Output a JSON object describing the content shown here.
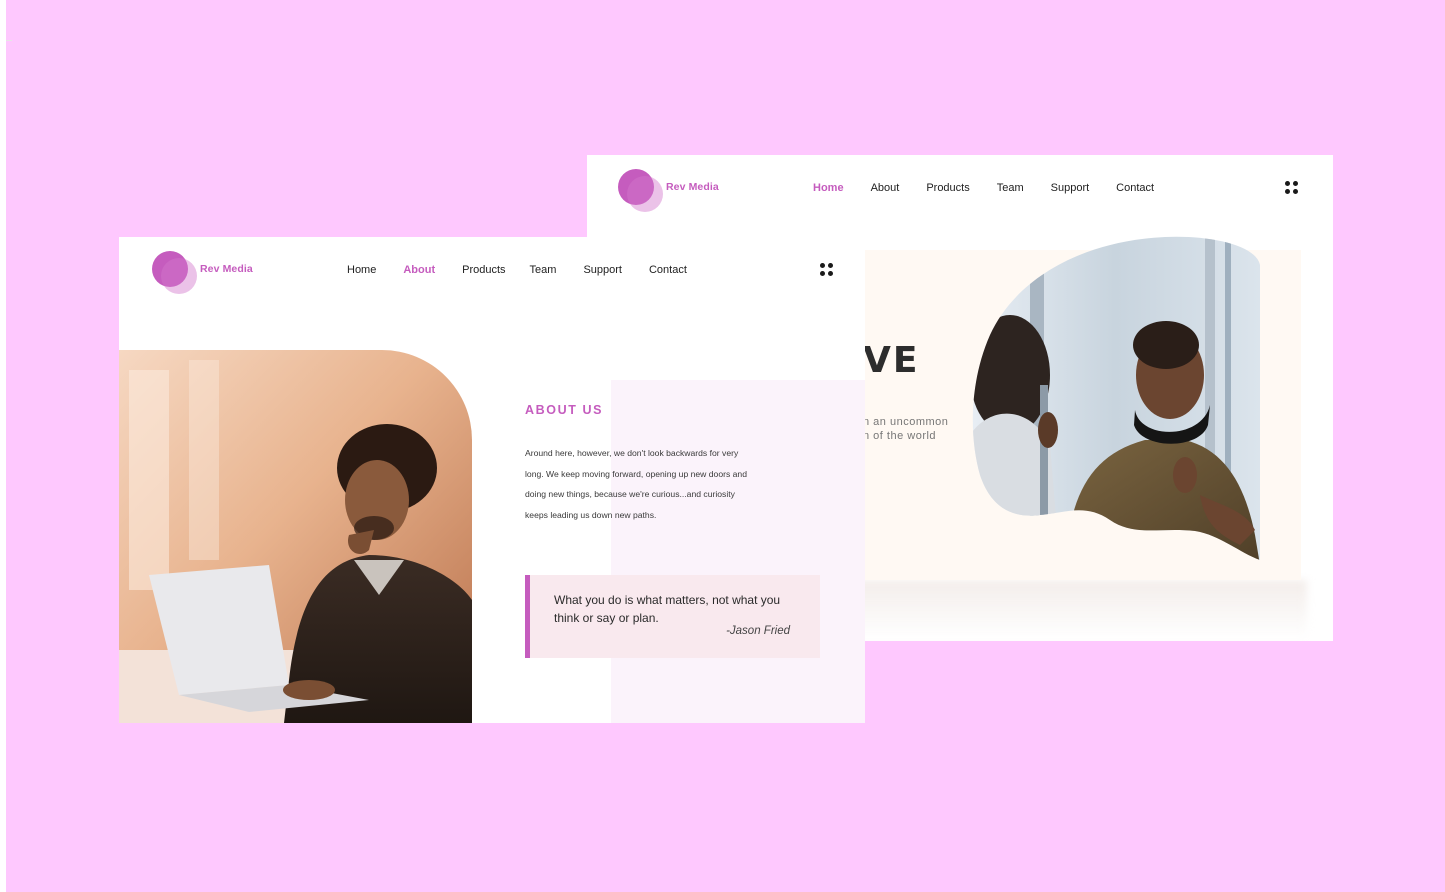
{
  "colors": {
    "background": "#fec8fe",
    "accent": "#c55cbe",
    "quote_bg": "#f9e9ee",
    "hero_bg": "#fff9f3"
  },
  "back_slide": {
    "brand": "Rev Media",
    "nav": [
      {
        "label": "Home",
        "active": true
      },
      {
        "label": "About",
        "active": false
      },
      {
        "label": "Products",
        "active": false
      },
      {
        "label": "Team",
        "active": false
      },
      {
        "label": "Support",
        "active": false
      },
      {
        "label": "Contact",
        "active": false
      }
    ],
    "menu_icon": "grid-dots-icon",
    "headline_visible": "VE",
    "subtext_line1": "n an uncommon",
    "subtext_line2": "n of the world",
    "hero_image": "man-with-headphones-photo"
  },
  "front_slide": {
    "brand": "Rev Media",
    "nav": [
      {
        "label": "Home",
        "active": false
      },
      {
        "label": "About",
        "active": true
      },
      {
        "label": "Products",
        "active": false
      },
      {
        "label": "Team",
        "active": false
      },
      {
        "label": "Support",
        "active": false
      },
      {
        "label": "Contact",
        "active": false
      }
    ],
    "menu_icon": "grid-dots-icon",
    "about_title": "ABOUT US",
    "body_lines": [
      "Around here, however, we don't look backwards for very",
      "long. We keep moving forward, opening up new doors and",
      "doing new things, because we're curious...and curiosity",
      "keeps leading us down new paths."
    ],
    "quote": "What you do is what matters, not what you think or say or plan.",
    "quote_author": "-Jason Fried",
    "photo": "man-thinking-at-laptop-photo"
  }
}
